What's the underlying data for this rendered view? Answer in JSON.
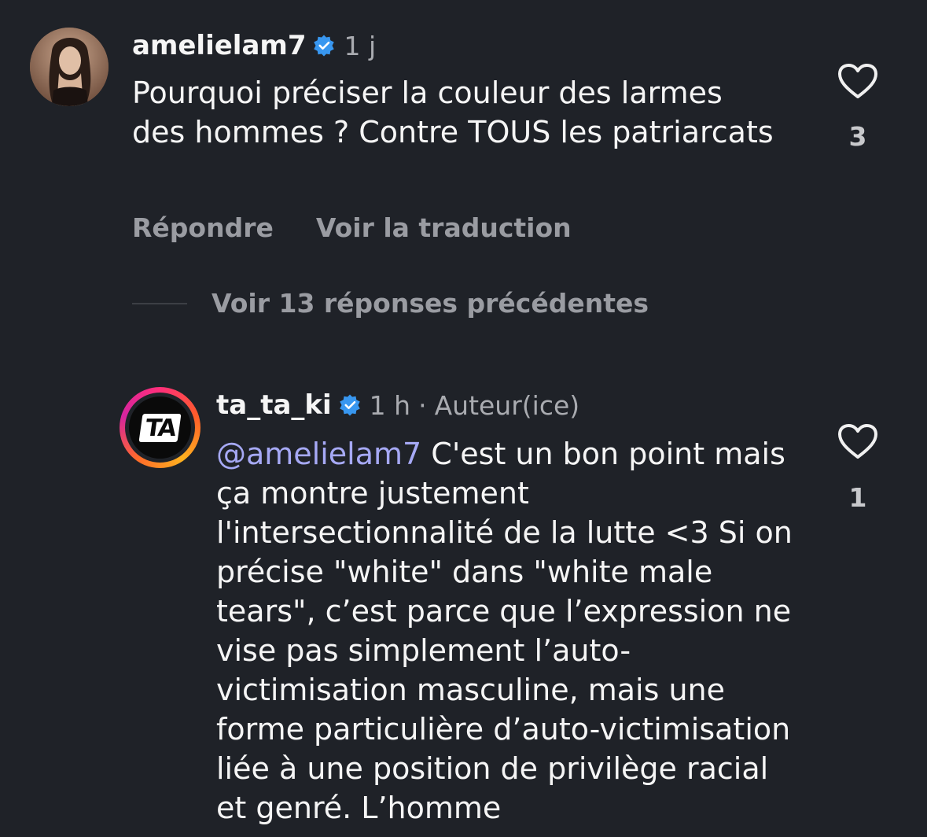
{
  "comments": [
    {
      "username": "amelielam7",
      "time": "1 j",
      "text": "Pourquoi préciser la couleur des larmes des hommes ? Contre TOUS les patriarcats",
      "like_count": "3",
      "actions": {
        "reply": "Répondre",
        "translate": "Voir la traduction"
      }
    }
  ],
  "view_replies": "Voir 13 réponses précédentes",
  "reply": {
    "username": "ta_ta_ki",
    "time": "1 h",
    "separator": "·",
    "author_badge": "Auteur(ice)",
    "avatar_text": "TA",
    "mention": "@amelielam7",
    "text": " C'est un bon point mais ça montre justement l'intersectionnalité de la lutte <3 Si on précise \"white\" dans \"white male tears\", c’est parce que l’expression ne vise pas simplement l’auto-victimisation masculine, mais une forme particulière d’auto-victimisation liée à une position de privilège racial et genré. L’homme",
    "like_count": "1"
  },
  "colors": {
    "background": "#1f2228",
    "verified": "#3897f0",
    "mention": "#a6a9f5",
    "muted": "#9a9ca2"
  },
  "icons": {
    "verified": "verified-badge-icon",
    "like": "heart-icon"
  }
}
